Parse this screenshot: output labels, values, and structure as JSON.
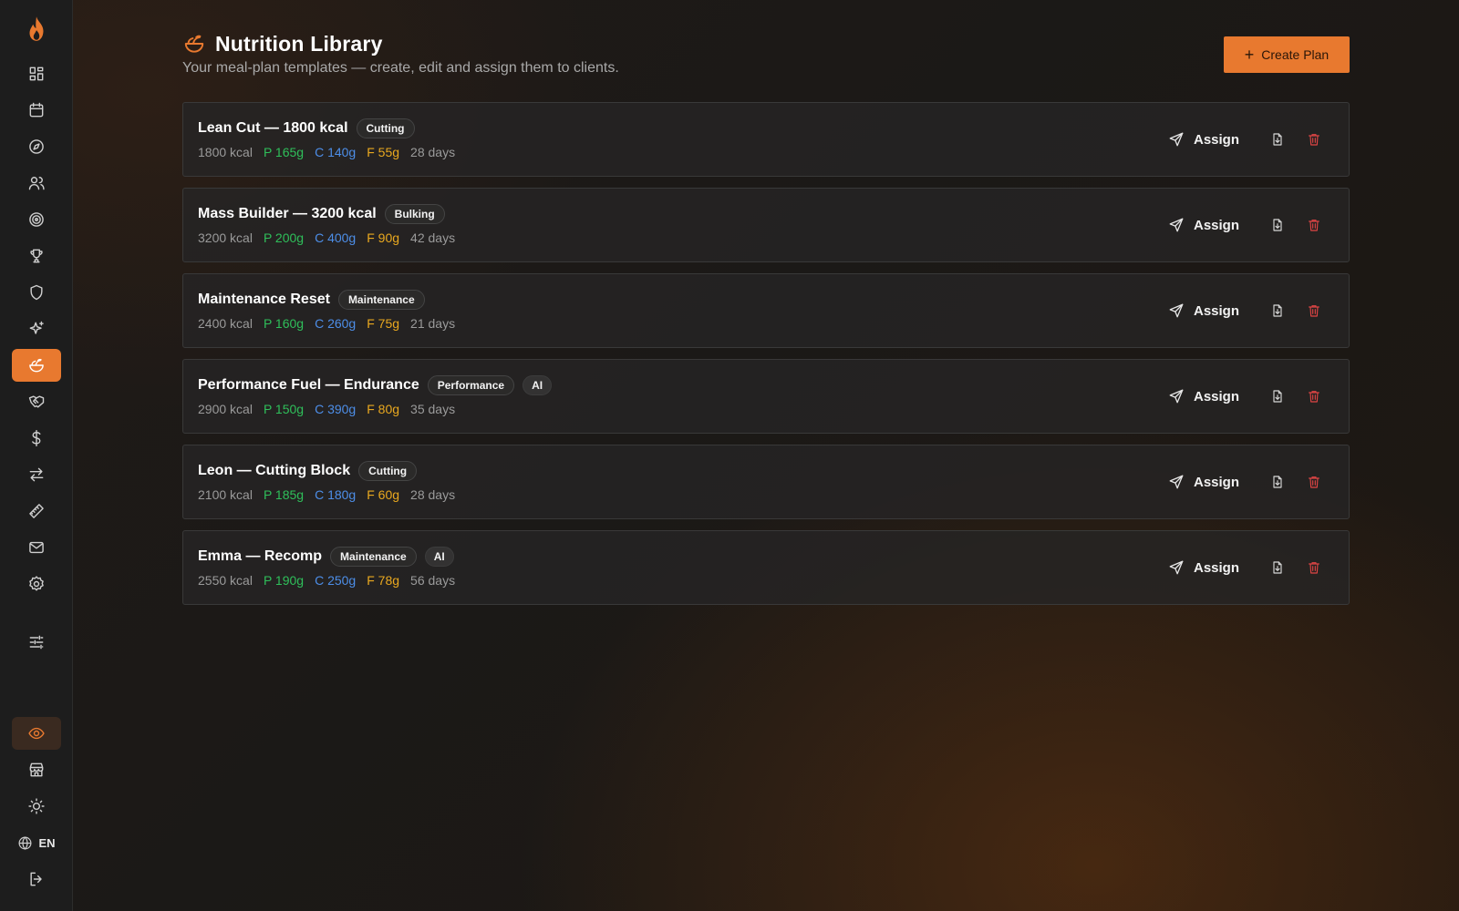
{
  "app": {
    "colors": {
      "accent": "#e8792f",
      "protein": "#2fbf5a",
      "carbs": "#4d8ee8",
      "fat": "#e9a81f",
      "danger": "#e04545"
    }
  },
  "sidebar": {
    "logo_icon": "flame-icon",
    "items": [
      {
        "icon": "grid-dashboard-icon",
        "active": false
      },
      {
        "icon": "calendar-icon",
        "active": false
      },
      {
        "icon": "compass-icon",
        "active": false
      },
      {
        "icon": "users-icon",
        "active": false
      },
      {
        "icon": "target-icon",
        "active": false
      },
      {
        "icon": "trophy-icon",
        "active": false
      },
      {
        "icon": "shield-icon",
        "active": false
      },
      {
        "icon": "sparkles-icon",
        "active": false
      },
      {
        "icon": "salad-bowl-icon",
        "active": true
      },
      {
        "icon": "handshake-icon",
        "active": false
      },
      {
        "icon": "dollar-icon",
        "active": false
      },
      {
        "icon": "transfer-arrows-icon",
        "active": false
      },
      {
        "icon": "ruler-icon",
        "active": false
      },
      {
        "icon": "mail-icon",
        "active": false
      },
      {
        "icon": "settings-icon",
        "active": false
      },
      {
        "icon": "sliders-icon",
        "active": false
      }
    ],
    "bottom": {
      "eye_icon": "eye-icon",
      "store_icon": "store-icon",
      "theme_icon": "sun-icon",
      "language": "EN",
      "logout_icon": "logout-icon"
    }
  },
  "header": {
    "title": "Nutrition Library",
    "icon": "salad-bowl-icon",
    "subtitle": "Your meal-plan templates — create, edit and assign them to clients.",
    "create_button": "Create Plan"
  },
  "plans": [
    {
      "name": "Lean Cut — 1800 kcal",
      "tags": [
        "Cutting"
      ],
      "ai": false,
      "kcal": "1800 kcal",
      "protein": "P 165g",
      "carbs": "C 140g",
      "fat": "F 55g",
      "days": "28 days"
    },
    {
      "name": "Mass Builder — 3200 kcal",
      "tags": [
        "Bulking"
      ],
      "ai": false,
      "kcal": "3200 kcal",
      "protein": "P 200g",
      "carbs": "C 400g",
      "fat": "F 90g",
      "days": "42 days"
    },
    {
      "name": "Maintenance Reset",
      "tags": [
        "Maintenance"
      ],
      "ai": false,
      "kcal": "2400 kcal",
      "protein": "P 160g",
      "carbs": "C 260g",
      "fat": "F 75g",
      "days": "21 days"
    },
    {
      "name": "Performance Fuel — Endurance",
      "tags": [
        "Performance"
      ],
      "ai": true,
      "kcal": "2900 kcal",
      "protein": "P 150g",
      "carbs": "C 390g",
      "fat": "F 80g",
      "days": "35 days"
    },
    {
      "name": "Leon — Cutting Block",
      "tags": [
        "Cutting"
      ],
      "ai": false,
      "kcal": "2100 kcal",
      "protein": "P 185g",
      "carbs": "C 180g",
      "fat": "F 60g",
      "days": "28 days"
    },
    {
      "name": "Emma — Recomp",
      "tags": [
        "Maintenance"
      ],
      "ai": true,
      "kcal": "2550 kcal",
      "protein": "P 190g",
      "carbs": "C 250g",
      "fat": "F 78g",
      "days": "56 days"
    }
  ],
  "labels": {
    "assign": "Assign",
    "ai_badge": "AI"
  }
}
